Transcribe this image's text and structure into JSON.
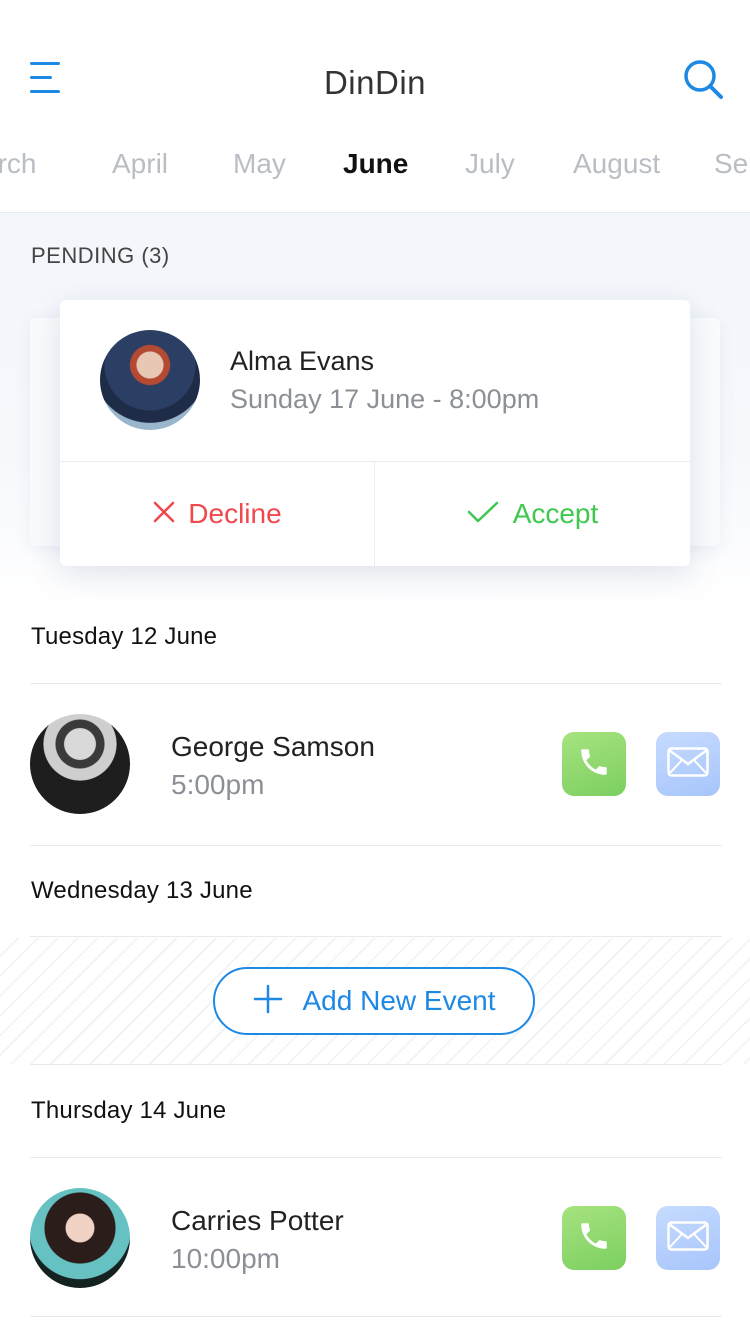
{
  "header": {
    "title": "DinDin",
    "accent_color": "#1e88e5"
  },
  "months": {
    "items": [
      "arch",
      "April",
      "May",
      "June",
      "July",
      "August",
      "Se"
    ],
    "selected": "June"
  },
  "pending": {
    "label": "PENDING (3)",
    "card": {
      "name": "Alma Evans",
      "datetime": "Sunday 17 June - 8:00pm",
      "decline_label": "Decline",
      "accept_label": "Accept",
      "decline_color": "#f0484d",
      "accept_color": "#3ec850"
    }
  },
  "days": [
    {
      "heading": "Tuesday 12 June",
      "event": {
        "name": "George Samson",
        "time": "5:00pm"
      }
    },
    {
      "heading": "Wednesday 13 June",
      "empty_action_label": "Add New Event"
    },
    {
      "heading": "Thursday 14 June",
      "event": {
        "name": "Carries Potter",
        "time": "10:00pm"
      }
    }
  ],
  "icons": {
    "menu": "menu-icon",
    "search": "search-icon",
    "decline": "close-icon",
    "accept": "check-icon",
    "call": "phone-icon",
    "mail": "mail-icon",
    "add": "plus-icon"
  }
}
